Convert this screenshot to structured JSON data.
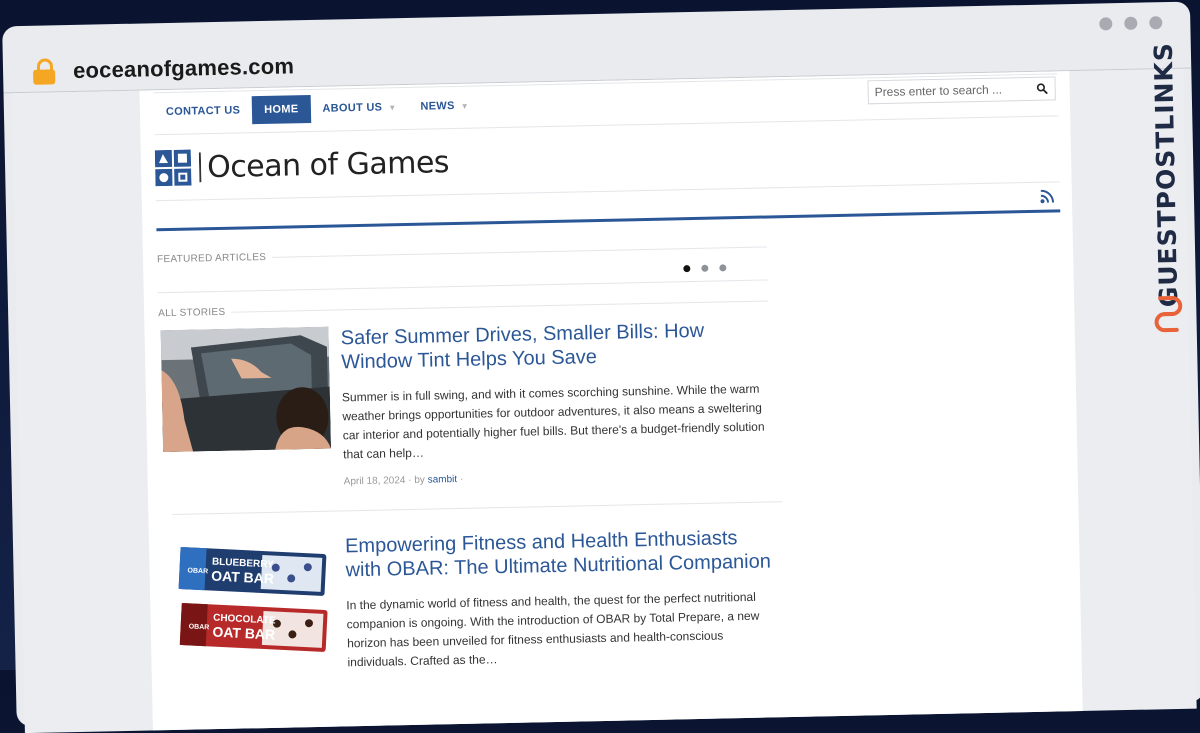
{
  "browser": {
    "url": "eoceanofgames.com",
    "icons": [
      "lock-icon",
      "window-dot"
    ]
  },
  "nav": {
    "items": [
      {
        "label": "CONTACT US",
        "active": false,
        "dropdown": false
      },
      {
        "label": "HOME",
        "active": true,
        "dropdown": false
      },
      {
        "label": "ABOUT US",
        "active": false,
        "dropdown": true
      },
      {
        "label": "NEWS",
        "active": false,
        "dropdown": true
      }
    ],
    "search_placeholder": "Press enter to search ..."
  },
  "site": {
    "name": "Ocean of Games"
  },
  "sections": {
    "featured": "FEATURED ARTICLES",
    "all_stories": "ALL STORIES"
  },
  "slider": {
    "total": 3,
    "active": 1
  },
  "articles": [
    {
      "title": "Safer Summer Drives, Smaller Bills: How Window Tint Helps You Save",
      "excerpt": "Summer is in full swing, and with it comes scorching sunshine. While the warm weather brings opportunities for outdoor adventures, it also means a sweltering car interior and potentially higher fuel bills. But there's a budget-friendly solution that can help…",
      "date": "April 18, 2024 · by",
      "author": "sambit",
      "trail": "·"
    },
    {
      "title": "Empowering Fitness and Health Enthusiasts with OBAR: The Ultimate Nutritional Companion",
      "excerpt": "In the dynamic world of fitness and health, the quest for the perfect nutritional companion is  ongoing. With the introduction of OBAR by Total Prepare, a new horizon has been unveiled for  fitness enthusiasts and health-conscious individuals. Crafted as the…"
    }
  ],
  "product_labels": {
    "bar1_flavor": "BLUEBERRY",
    "bar1_name": "OAT BAR",
    "bar2_flavor": "CHOCOLATE",
    "bar2_name": "OAT BAR",
    "brand": "OBAR"
  },
  "watermark": {
    "text": "GUESTPOSTLINKS"
  },
  "colors": {
    "accent": "#2b5797",
    "lock": "#f5a623",
    "watermark_glyph": "#e8623a"
  }
}
